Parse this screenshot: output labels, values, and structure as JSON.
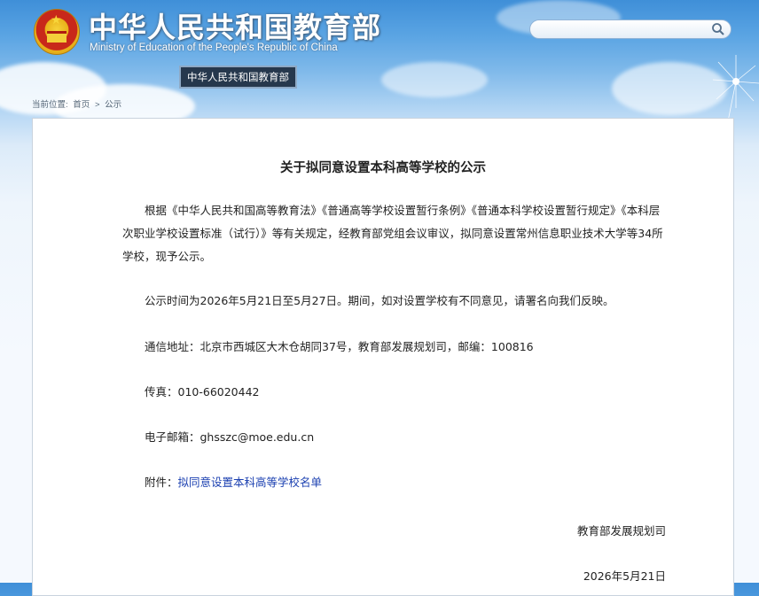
{
  "header": {
    "site_title": "中华人民共和国教育部",
    "site_subtitle": "Ministry of Education of the People's Republic of China",
    "tag": "中华人民共和国教育部"
  },
  "search": {
    "placeholder": "",
    "icon": "search-icon"
  },
  "breadcrumb": {
    "prefix": "当前位置:",
    "items": [
      "首页",
      "公示"
    ],
    "separator": ">"
  },
  "article": {
    "title": "关于拟同意设置本科高等学校的公示",
    "intro": "　　根据《中华人民共和国高等教育法》《普通高等学校设置暂行条例》《普通本科学校设置暂行规定》《本科层次职业学校设置标准（试行）》等有关规定，经教育部党组会议审议，拟同意设置常州信息职业技术大学等34所学校，现予公示。",
    "period": "　　公示时间为2026年5月21日至5月27日。期间，如对设置学校有不同意见，请署名向我们反映。",
    "address": "　　通信地址：北京市西城区大木仓胡同37号，教育部发展规划司，邮编：100816",
    "fax": "　　传真：010-66020442",
    "email": "　　电子邮箱：ghsszc@moe.edu.cn",
    "attachment_label": "　　附件：",
    "attachment_link": "拟同意设置本科高等学校名单",
    "signature": "教育部发展规划司",
    "date": "2026年5月21日"
  },
  "colors": {
    "link": "#1a3fb0",
    "tag_bg": "#26384d"
  }
}
